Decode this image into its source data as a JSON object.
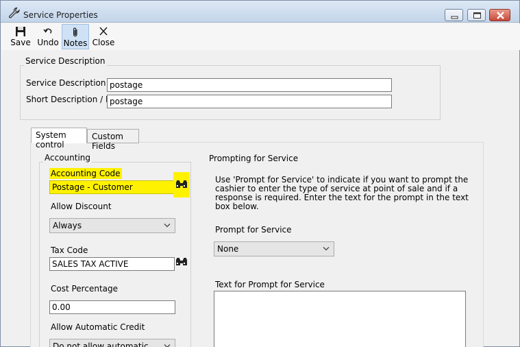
{
  "window": {
    "title": "Service Properties"
  },
  "toolbar": {
    "save_label": "Save",
    "undo_label": "Undo",
    "notes_label": "Notes",
    "close_label": "Close"
  },
  "service_description": {
    "group_title": "Service Description",
    "service_description_label": "Service Description",
    "service_description_value": "postage",
    "short_description_label": "Short Description / ID",
    "short_description_value": "postage"
  },
  "tabs": [
    {
      "label": "System control",
      "active": true
    },
    {
      "label": "Custom Fields",
      "active": false
    }
  ],
  "accounting": {
    "group_title": "Accounting",
    "accounting_code_label": "Accounting Code",
    "accounting_code_value": "Postage - Customer",
    "allow_discount_label": "Allow Discount",
    "allow_discount_value": "Always",
    "tax_code_label": "Tax Code",
    "tax_code_value": "SALES TAX ACTIVE",
    "cost_percentage_label": "Cost Percentage",
    "cost_percentage_value": "0.00",
    "allow_automatic_credit_label": "Allow Automatic Credit",
    "allow_automatic_credit_value": "Do not allow automatic credit"
  },
  "prompting": {
    "group_title": "Prompting for Service",
    "help_text": "Use 'Prompt for Service' to indicate if you want to prompt the cashier to enter the type of service at point of sale and if a response is required. Enter the text for the prompt in the text box below.",
    "prompt_label": "Prompt for Service",
    "prompt_value": "None",
    "text_for_prompt_label": "Text for Prompt for Service",
    "text_for_prompt_value": ""
  },
  "colors": {
    "highlight": "#fff200",
    "window_bg": "#f0f0f0",
    "active_toolbar": "#cfe2f5"
  },
  "icons": {
    "title": "wrench-icon",
    "save": "floppy-disk-icon",
    "undo": "undo-arrow-icon",
    "notes": "paperclip-icon",
    "close": "x-close-icon",
    "lookup": "binoculars-icon"
  }
}
